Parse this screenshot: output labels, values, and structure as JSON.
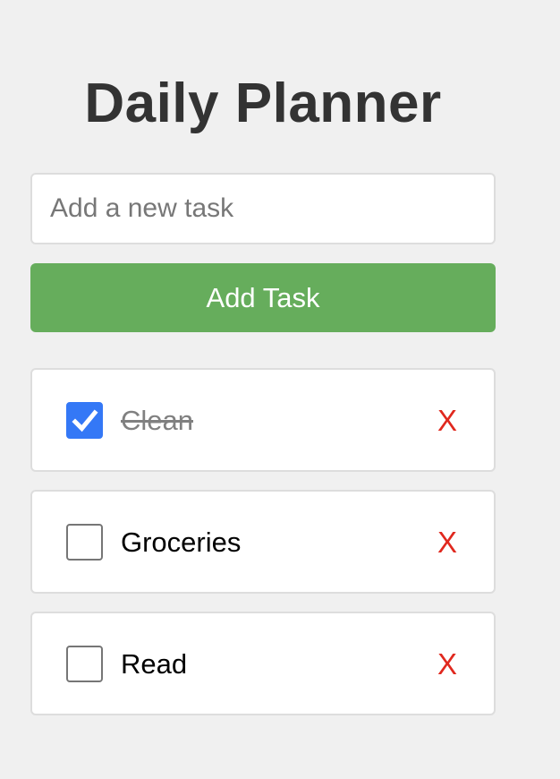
{
  "app": {
    "title": "Daily Planner"
  },
  "input": {
    "placeholder": "Add a new task",
    "value": ""
  },
  "add_button": {
    "label": "Add Task"
  },
  "tasks": [
    {
      "text": "Clean",
      "completed": true,
      "delete_label": "X"
    },
    {
      "text": "Groceries",
      "completed": false,
      "delete_label": "X"
    },
    {
      "text": "Read",
      "completed": false,
      "delete_label": "X"
    }
  ],
  "colors": {
    "background": "#f0f0f0",
    "title": "#333333",
    "add_button": "#66ad5c",
    "checkbox_checked": "#3478f6",
    "delete": "#e0281e",
    "completed_text": "#808080"
  },
  "icons": {
    "checkmark": "checkmark-icon"
  }
}
